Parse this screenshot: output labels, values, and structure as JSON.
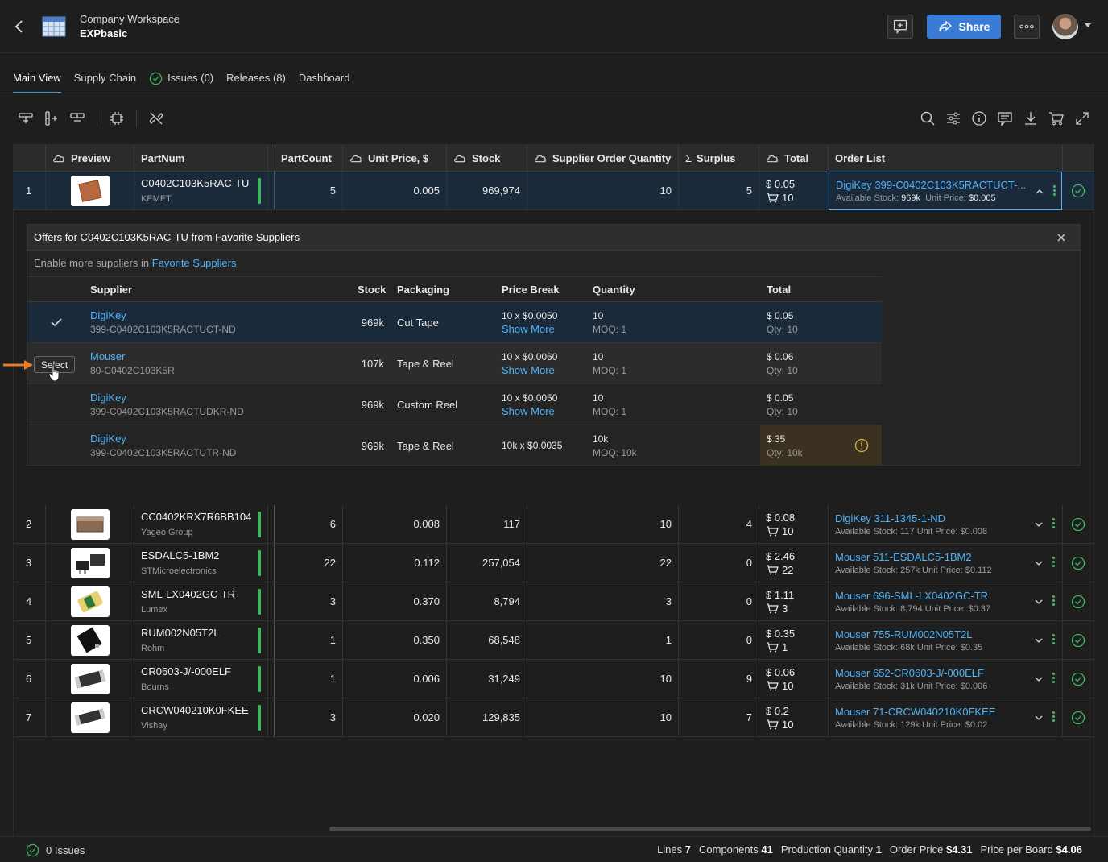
{
  "header": {
    "workspace_name": "Company Workspace",
    "project_name": "EXPbasic",
    "share_label": "Share",
    "more_label": "…"
  },
  "tabs": [
    {
      "label": "Main View",
      "active": true
    },
    {
      "label": "Supply Chain"
    },
    {
      "label": "Issues (0)",
      "icon": "check-circle-icon"
    },
    {
      "label": "Releases (8)"
    },
    {
      "label": "Dashboard"
    }
  ],
  "columns": {
    "preview": "Preview",
    "partnum": "PartNum",
    "partcount": "PartCount",
    "unit_price": "Unit Price, $",
    "stock": "Stock",
    "supplier_order_qty": "Supplier Order Quantity",
    "surplus": "Surplus",
    "total": "Total",
    "order_list": "Order List",
    "sigma": "Σ"
  },
  "rows": [
    {
      "idx": "1",
      "part": "C0402C103K5RAC-TU",
      "mfr": "KEMET",
      "count": "5",
      "price": "0.005",
      "stock": "969,974",
      "soq": "10",
      "surplus": "5",
      "total": "$ 0.05",
      "cart": "10",
      "order": "DigiKey 399-C0402C103K5RACTUCT-...",
      "avail_label": "Available Stock:",
      "avail": "969k",
      "up_label": "Unit Price:",
      "up": "$0.005"
    },
    {
      "idx": "2",
      "part": "CC0402KRX7R6BB104",
      "mfr": "Yageo Group",
      "count": "6",
      "price": "0.008",
      "stock": "117",
      "soq": "10",
      "surplus": "4",
      "total": "$ 0.08",
      "cart": "10",
      "order": "DigiKey 311-1345-1-ND",
      "avail_sub": "Available Stock: 117  Unit Price: $0.008"
    },
    {
      "idx": "3",
      "part": "ESDALC5-1BM2",
      "mfr": "STMicroelectronics",
      "count": "22",
      "price": "0.112",
      "stock": "257,054",
      "soq": "22",
      "surplus": "0",
      "total": "$ 2.46",
      "cart": "22",
      "order": "Mouser 511-ESDALC5-1BM2",
      "avail_sub": "Available Stock: 257k  Unit Price: $0.112"
    },
    {
      "idx": "4",
      "part": "SML-LX0402GC-TR",
      "mfr": "Lumex",
      "count": "3",
      "price": "0.370",
      "stock": "8,794",
      "soq": "3",
      "surplus": "0",
      "total": "$ 1.11",
      "cart": "3",
      "order": "Mouser 696-SML-LX0402GC-TR",
      "avail_sub": "Available Stock: 8,794  Unit Price: $0.37"
    },
    {
      "idx": "5",
      "part": "RUM002N05T2L",
      "mfr": "Rohm",
      "count": "1",
      "price": "0.350",
      "stock": "68,548",
      "soq": "1",
      "surplus": "0",
      "total": "$ 0.35",
      "cart": "1",
      "order": "Mouser 755-RUM002N05T2L",
      "avail_sub": "Available Stock: 68k  Unit Price: $0.35"
    },
    {
      "idx": "6",
      "part": "CR0603-J/-000ELF",
      "mfr": "Bourns",
      "count": "1",
      "price": "0.006",
      "stock": "31,249",
      "soq": "10",
      "surplus": "9",
      "total": "$ 0.06",
      "cart": "10",
      "order": "Mouser 652-CR0603-J/-000ELF",
      "avail_sub": "Available Stock: 31k  Unit Price: $0.006"
    },
    {
      "idx": "7",
      "part": "CRCW040210K0FKEE",
      "mfr": "Vishay",
      "count": "3",
      "price": "0.020",
      "stock": "129,835",
      "soq": "10",
      "surplus": "7",
      "total": "$ 0.2",
      "cart": "10",
      "order": "Mouser 71-CRCW040210K0FKEE",
      "avail_sub": "Available Stock: 129k  Unit Price: $0.02"
    }
  ],
  "offers": {
    "title": "Offers for C0402C103K5RAC-TU from Favorite Suppliers",
    "enable_prefix": "Enable more suppliers in",
    "enable_link": "Favorite Suppliers",
    "headers": {
      "supplier": "Supplier",
      "stock": "Stock",
      "packaging": "Packaging",
      "price_break": "Price Break",
      "quantity": "Quantity",
      "total": "Total"
    },
    "select_label": "Select",
    "show_more": "Show More",
    "items": [
      {
        "supplier": "DigiKey",
        "sku": "399-C0402C103K5RACTUCT-ND",
        "stock": "969k",
        "packaging": "Cut Tape",
        "price_break": "10 x $0.0050",
        "qty": "10",
        "moq": "MOQ: 1",
        "total": "$ 0.05",
        "qty_total": "Qty: 10"
      },
      {
        "supplier": "Mouser",
        "sku": "80-C0402C103K5R",
        "stock": "107k",
        "packaging": "Tape & Reel",
        "price_break": "10 x $0.0060",
        "qty": "10",
        "moq": "MOQ: 1",
        "total": "$ 0.06",
        "qty_total": "Qty: 10"
      },
      {
        "supplier": "DigiKey",
        "sku": "399-C0402C103K5RACTUDKR-ND",
        "stock": "969k",
        "packaging": "Custom Reel",
        "price_break": "10 x $0.0050",
        "qty": "10",
        "moq": "MOQ: 1",
        "total": "$ 0.05",
        "qty_total": "Qty: 10"
      },
      {
        "supplier": "DigiKey",
        "sku": "399-C0402C103K5RACTUTR-ND",
        "stock": "969k",
        "packaging": "Tape & Reel",
        "price_break": "10k x $0.0035",
        "qty": "10k",
        "moq": "MOQ: 10k",
        "total": "$ 35",
        "qty_total": "Qty: 10k"
      }
    ]
  },
  "status": {
    "issues": "0 Issues",
    "lines_label": "Lines",
    "lines": "7",
    "components_label": "Components",
    "components": "41",
    "prodqty_label": "Production Quantity",
    "prodqty": "1",
    "order_price_label": "Order Price",
    "order_price": "$4.31",
    "ppb_label": "Price per Board",
    "ppb": "$4.06"
  },
  "colors": {
    "accent": "#3a7bd5",
    "link": "#4fb3f7",
    "ok": "#3cb65c",
    "warn": "#d8b43a"
  }
}
